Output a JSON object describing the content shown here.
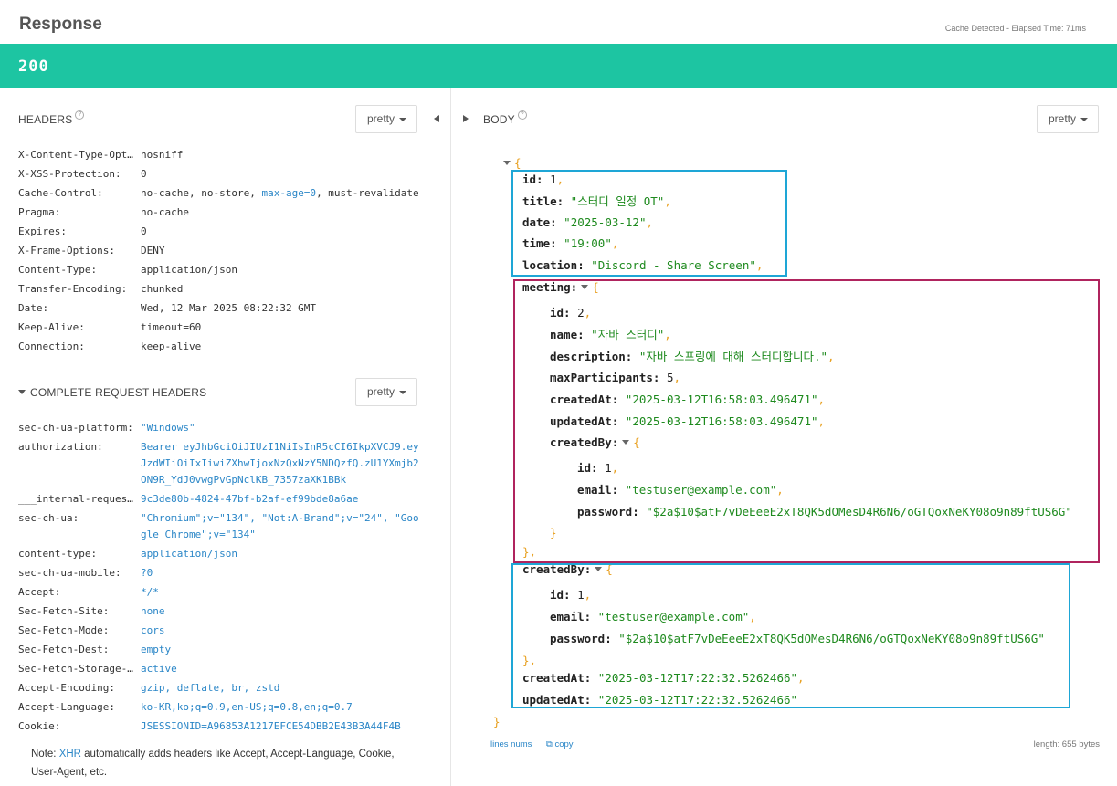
{
  "header": {
    "title": "Response",
    "elapsed": "Cache Detected - Elapsed Time: 71ms"
  },
  "status": {
    "code": "200",
    "color": "#1dc5a2"
  },
  "headers_section": {
    "label": "HEADERS",
    "format": "pretty",
    "rows": [
      {
        "key": "X-Content-Type-Opt…",
        "value": "nosniff"
      },
      {
        "key": "X-XSS-Protection:",
        "value": "0"
      },
      {
        "key": "Cache-Control:",
        "value": "no-cache, no-store, max-age=0, must-revalidate"
      },
      {
        "key": "Pragma:",
        "value": "no-cache"
      },
      {
        "key": "Expires:",
        "value": "0"
      },
      {
        "key": "X-Frame-Options:",
        "value": "DENY"
      },
      {
        "key": "Content-Type:",
        "value": "application/json"
      },
      {
        "key": "Transfer-Encoding:",
        "value": "chunked"
      },
      {
        "key": "Date:",
        "value": "Wed, 12 Mar 2025 08:22:32 GMT"
      },
      {
        "key": "Keep-Alive:",
        "value": "timeout=60"
      },
      {
        "key": "Connection:",
        "value": "keep-alive"
      }
    ]
  },
  "request_section": {
    "label": "COMPLETE REQUEST HEADERS",
    "format": "pretty",
    "rows": [
      {
        "key": "sec-ch-ua-platform:",
        "value": "\"Windows\""
      },
      {
        "key": "authorization:",
        "value": "Bearer eyJhbGciOiJIUzI1NiIsInR5cCI6IkpXVCJ9.eyJzdWIiOiIxIiwiZXhwIjoxNzQxNzY5NDQzfQ.zU1YXmjb2ON9R_YdJ0vwgPvGpNclKB_7357zaXK1BBk"
      },
      {
        "key": "___internal-reques…",
        "value": "9c3de80b-4824-47bf-b2af-ef99bde8a6ae"
      },
      {
        "key": "sec-ch-ua:",
        "value": "\"Chromium\";v=\"134\", \"Not:A-Brand\";v=\"24\", \"Google Chrome\";v=\"134\""
      },
      {
        "key": "content-type:",
        "value": "application/json"
      },
      {
        "key": "sec-ch-ua-mobile:",
        "value": "?0"
      },
      {
        "key": "Accept:",
        "value": "*/*"
      },
      {
        "key": "Sec-Fetch-Site:",
        "value": "none"
      },
      {
        "key": "Sec-Fetch-Mode:",
        "value": "cors"
      },
      {
        "key": "Sec-Fetch-Dest:",
        "value": "empty"
      },
      {
        "key": "Sec-Fetch-Storage-…",
        "value": "active"
      },
      {
        "key": "Accept-Encoding:",
        "value": "gzip, deflate, br, zstd"
      },
      {
        "key": "Accept-Language:",
        "value": "ko-KR,ko;q=0.9,en-US;q=0.8,en;q=0.7"
      },
      {
        "key": "Cookie:",
        "value": "JSESSIONID=A96853A1217EFCE54DBB2E43B3A44F4B"
      }
    ]
  },
  "note": {
    "prefix": "Note: ",
    "link": "XHR",
    "suffix": " automatically adds headers like Accept, Accept-Language, Cookie, User-Agent, etc."
  },
  "body_section": {
    "label": "BODY",
    "format": "pretty",
    "lines": [
      {
        "parts": [
          [
            "p",
            "{"
          ]
        ]
      },
      {
        "parts": [
          [
            "k",
            "id:"
          ],
          [
            "n",
            " 1"
          ],
          [
            "p",
            ","
          ]
        ]
      },
      {
        "parts": [
          [
            "k",
            "title:"
          ],
          [
            "s",
            " \"스터디 일정 OT\""
          ],
          [
            "p",
            ","
          ]
        ]
      },
      {
        "parts": [
          [
            "k",
            "date:"
          ],
          [
            "s",
            " \"2025-03-12\""
          ],
          [
            "p",
            ","
          ]
        ]
      },
      {
        "parts": [
          [
            "k",
            "time:"
          ],
          [
            "s",
            " \"19:00\""
          ],
          [
            "p",
            ","
          ]
        ]
      },
      {
        "parts": [
          [
            "k",
            "location:"
          ],
          [
            "s",
            " \"Discord - Share Screen\""
          ],
          [
            "p",
            ","
          ]
        ]
      },
      {
        "parts": [
          [
            "k",
            "meeting:"
          ],
          [
            "t",
            ""
          ],
          [
            "p",
            "{"
          ]
        ]
      },
      {
        "parts": [
          [
            "k",
            "id:"
          ],
          [
            "n",
            " 2"
          ],
          [
            "p",
            ","
          ]
        ]
      },
      {
        "parts": [
          [
            "k",
            "name:"
          ],
          [
            "s",
            " \"자바 스터디\""
          ],
          [
            "p",
            ","
          ]
        ]
      },
      {
        "parts": [
          [
            "k",
            "description:"
          ],
          [
            "s",
            " \"자바 스프링에 대해 스터디합니다.\""
          ],
          [
            "p",
            ","
          ]
        ]
      },
      {
        "parts": [
          [
            "k",
            "maxParticipants:"
          ],
          [
            "n",
            " 5"
          ],
          [
            "p",
            ","
          ]
        ]
      },
      {
        "parts": [
          [
            "k",
            "createdAt:"
          ],
          [
            "s",
            " \"2025-03-12T16:58:03.496471\""
          ],
          [
            "p",
            ","
          ]
        ]
      },
      {
        "parts": [
          [
            "k",
            "updatedAt:"
          ],
          [
            "s",
            " \"2025-03-12T16:58:03.496471\""
          ],
          [
            "p",
            ","
          ]
        ]
      },
      {
        "parts": [
          [
            "k",
            "createdBy:"
          ],
          [
            "t",
            ""
          ],
          [
            "p",
            "{"
          ]
        ]
      },
      {
        "parts": [
          [
            "k",
            "id:"
          ],
          [
            "n",
            " 1"
          ],
          [
            "p",
            ","
          ]
        ]
      },
      {
        "parts": [
          [
            "k",
            "email:"
          ],
          [
            "s",
            " \"testuser@example.com\""
          ],
          [
            "p",
            ","
          ]
        ]
      },
      {
        "parts": [
          [
            "k",
            "password:"
          ],
          [
            "s",
            " \"$2a$10$atF7vDeEeeE2xT8QK5dOMesD4R6N6/oGTQoxNeKY08o9n89ftUS6G\""
          ]
        ]
      },
      {
        "parts": [
          [
            "p",
            "}"
          ]
        ]
      },
      {
        "parts": [
          [
            "p",
            "},"
          ]
        ]
      },
      {
        "parts": [
          [
            "k",
            "createdBy:"
          ],
          [
            "t",
            ""
          ],
          [
            "p",
            "{"
          ]
        ]
      },
      {
        "parts": [
          [
            "k",
            "id:"
          ],
          [
            "n",
            " 1"
          ],
          [
            "p",
            ","
          ]
        ]
      },
      {
        "parts": [
          [
            "k",
            "email:"
          ],
          [
            "s",
            " \"testuser@example.com\""
          ],
          [
            "p",
            ","
          ]
        ]
      },
      {
        "parts": [
          [
            "k",
            "password:"
          ],
          [
            "s",
            " \"$2a$10$atF7vDeEeeE2xT8QK5dOMesD4R6N6/oGTQoxNeKY08o9n89ftUS6G\""
          ]
        ]
      },
      {
        "parts": [
          [
            "p",
            "},"
          ]
        ]
      },
      {
        "parts": [
          [
            "k",
            "createdAt:"
          ],
          [
            "s",
            " \"2025-03-12T17:22:32.5262466\""
          ],
          [
            "p",
            ","
          ]
        ]
      },
      {
        "parts": [
          [
            "k",
            "updatedAt:"
          ],
          [
            "s",
            " \"2025-03-12T17:22:32.5262466\""
          ]
        ]
      },
      {
        "parts": [
          [
            "p",
            "}"
          ]
        ]
      }
    ],
    "footer": {
      "line_nums": "lines nums",
      "copy": "copy",
      "length": "length: 655 bytes"
    },
    "highlight_colors": {
      "cyan": "#1ea6d6",
      "magenta": "#b0245e"
    }
  }
}
